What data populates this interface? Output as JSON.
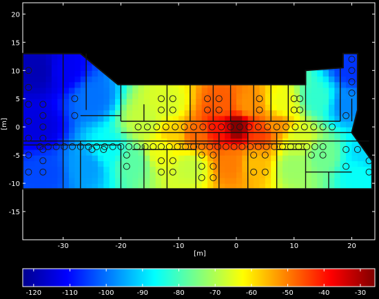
{
  "chart_data": {
    "type": "heatmap",
    "title": "",
    "xlabel": "[m]",
    "ylabel": "[m]",
    "xlim": [
      -37,
      24
    ],
    "ylim": [
      -20,
      22
    ],
    "xticks": [
      -30,
      -20,
      -10,
      0,
      10,
      20
    ],
    "yticks": [
      -15,
      -10,
      -5,
      0,
      5,
      10,
      15,
      20
    ],
    "colorbar": {
      "range": [
        -123,
        -26
      ],
      "ticks": [
        -120,
        -110,
        -100,
        -90,
        -80,
        -70,
        -60,
        -50,
        -40,
        -30
      ],
      "colormap": "jet"
    },
    "floor_outline": [
      [
        -37,
        13
      ],
      [
        -27,
        13
      ],
      [
        -20.5,
        7.5
      ],
      [
        12,
        7.5
      ],
      [
        12,
        10
      ],
      [
        18.5,
        10.5
      ],
      [
        18.5,
        13
      ],
      [
        21,
        13
      ],
      [
        21,
        3
      ],
      [
        20,
        -1
      ],
      [
        23.5,
        -6
      ],
      [
        23.5,
        -11
      ],
      [
        -37,
        -11
      ]
    ],
    "sources": [
      {
        "x": 0,
        "y": 0,
        "value": -26
      },
      {
        "x": -3,
        "y": -0.5,
        "value": -40
      },
      {
        "x": 4,
        "y": -1,
        "value": -44
      },
      {
        "x": -7,
        "y": -1.5,
        "value": -48
      },
      {
        "x": -2,
        "y": 4,
        "value": -47
      },
      {
        "x": 2,
        "y": 4,
        "value": -52
      },
      {
        "x": -1,
        "y": -6.5,
        "value": -50
      },
      {
        "x": 3,
        "y": -6.5,
        "value": -56
      },
      {
        "x": 7,
        "y": 0.5,
        "value": -52
      },
      {
        "x": -11,
        "y": -1.5,
        "value": -58
      },
      {
        "x": -13,
        "y": -4,
        "value": -64
      },
      {
        "x": 11,
        "y": -2,
        "value": -66
      },
      {
        "x": -8,
        "y": -7,
        "value": -68
      },
      {
        "x": 10,
        "y": -7,
        "value": -72
      },
      {
        "x": -12,
        "y": 4,
        "value": -66
      },
      {
        "x": 8,
        "y": 4,
        "value": -64
      },
      {
        "x": -16,
        "y": 1,
        "value": -68
      },
      {
        "x": -18,
        "y": -6,
        "value": -78
      },
      {
        "x": 15,
        "y": -5,
        "value": -76
      },
      {
        "x": 14,
        "y": 5,
        "value": -82
      },
      {
        "x": -22,
        "y": -4,
        "value": -86
      },
      {
        "x": -26,
        "y": -7,
        "value": -96
      },
      {
        "x": -25,
        "y": 5,
        "value": -100
      },
      {
        "x": -30,
        "y": 10,
        "value": -112
      },
      {
        "x": -34,
        "y": 10,
        "value": -118
      },
      {
        "x": -34,
        "y": 0,
        "value": -114
      },
      {
        "x": -33,
        "y": -8,
        "value": -104
      },
      {
        "x": 20,
        "y": 10,
        "value": -106
      },
      {
        "x": 19,
        "y": 4,
        "value": -98
      },
      {
        "x": 21,
        "y": -8,
        "value": -86
      },
      {
        "x": 22,
        "y": -5,
        "value": -90
      }
    ]
  }
}
